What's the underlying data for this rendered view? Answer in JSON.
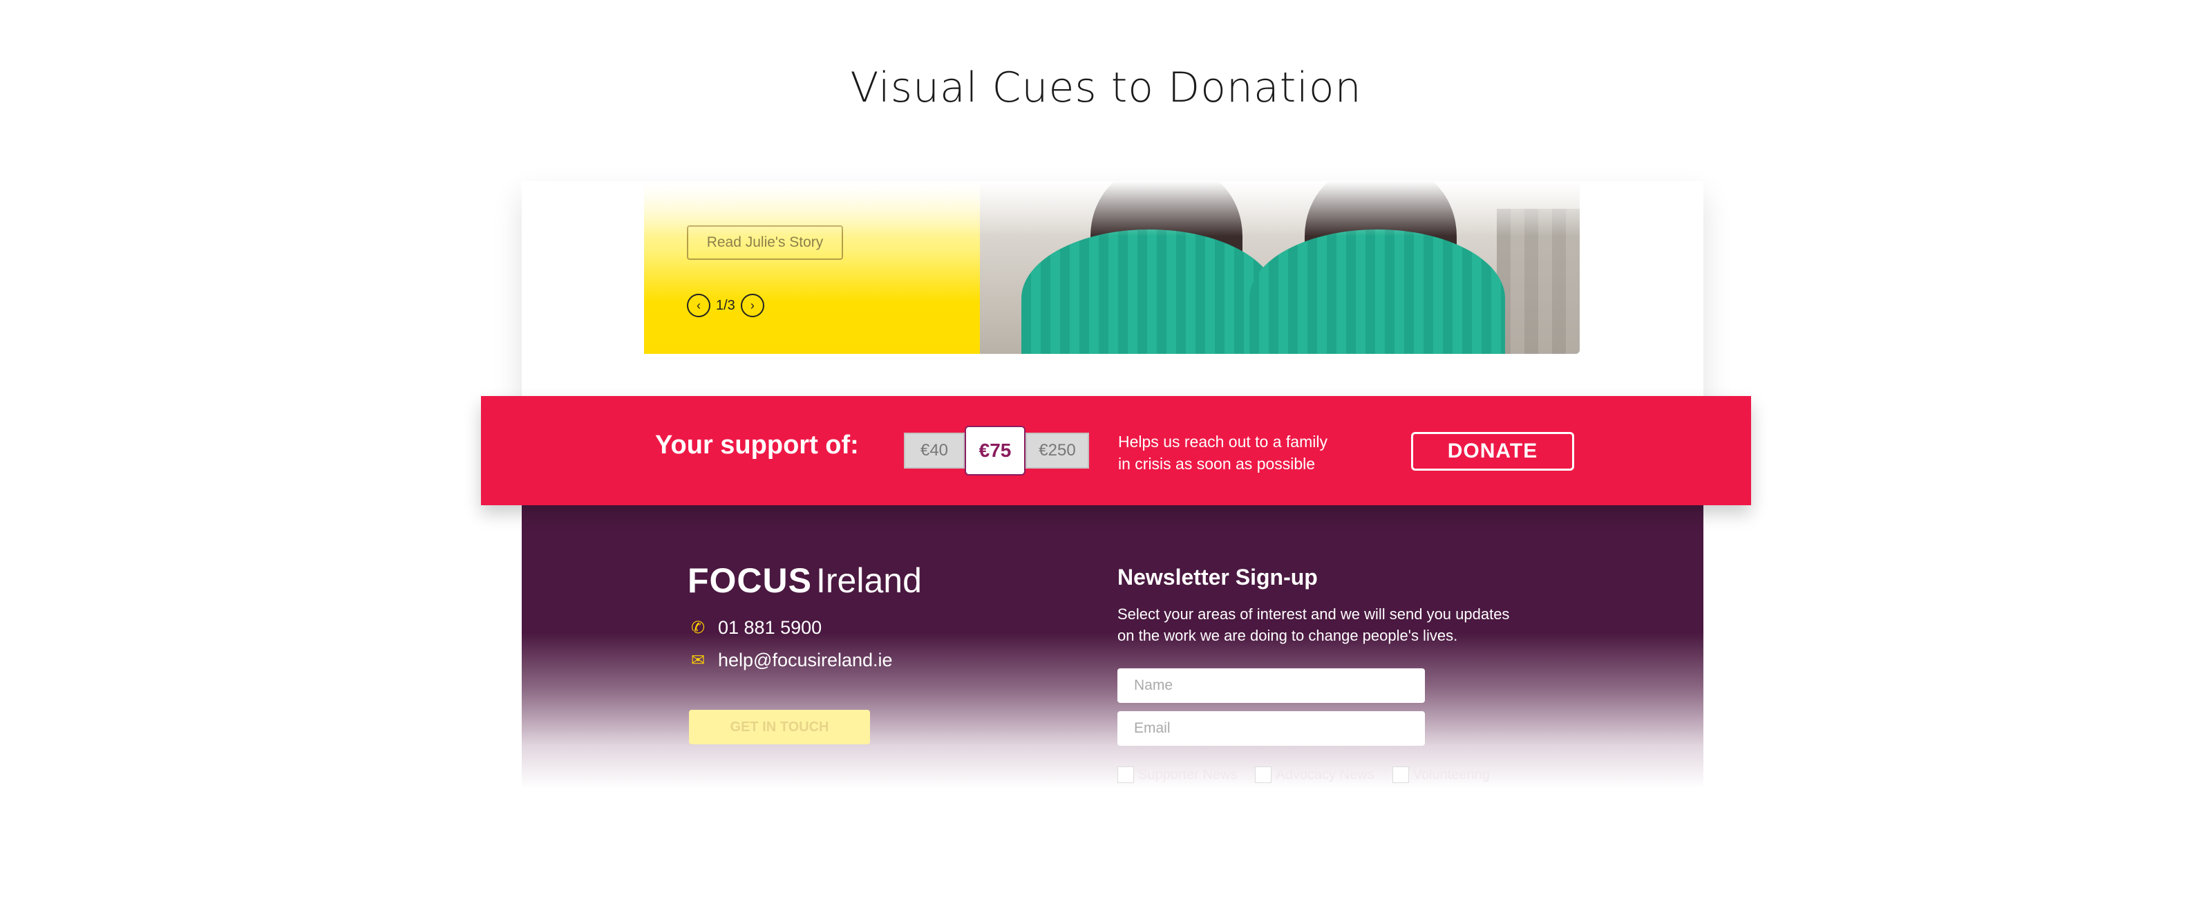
{
  "page": {
    "title": "Visual Cues to Donation"
  },
  "story": {
    "button_label": "Read Julie's Story",
    "pager": {
      "current": "1/3",
      "prev_icon": "chevron-left-icon",
      "next_icon": "chevron-right-icon"
    }
  },
  "donation": {
    "label": "Your support of:",
    "amounts": [
      "€40",
      "€75",
      "€250"
    ],
    "selected": "€75",
    "help_line1": "Helps us reach out to a family",
    "help_line2": "in crisis as soon as possible",
    "button_label": "DONATE",
    "colors": {
      "band": "#ee1846",
      "selected_text": "#8a1c5e"
    }
  },
  "footer": {
    "logo_focus": "FOCUS",
    "logo_ireland": "Ireland",
    "phone": "01 881 5900",
    "email": "help@focusireland.ie",
    "contact_button": "GET IN TOUCH",
    "newsletter": {
      "title": "Newsletter Sign-up",
      "description_line1": "Select your areas of interest and we will send you updates",
      "description_line2": "on the work we are doing to change people's lives.",
      "name_placeholder": "Name",
      "email_placeholder": "Email",
      "checkboxes": [
        "Supporter News",
        "Advocacy News",
        "Volunteering"
      ]
    },
    "colors": {
      "background": "#4a1840",
      "accent": "#ffd000"
    }
  }
}
